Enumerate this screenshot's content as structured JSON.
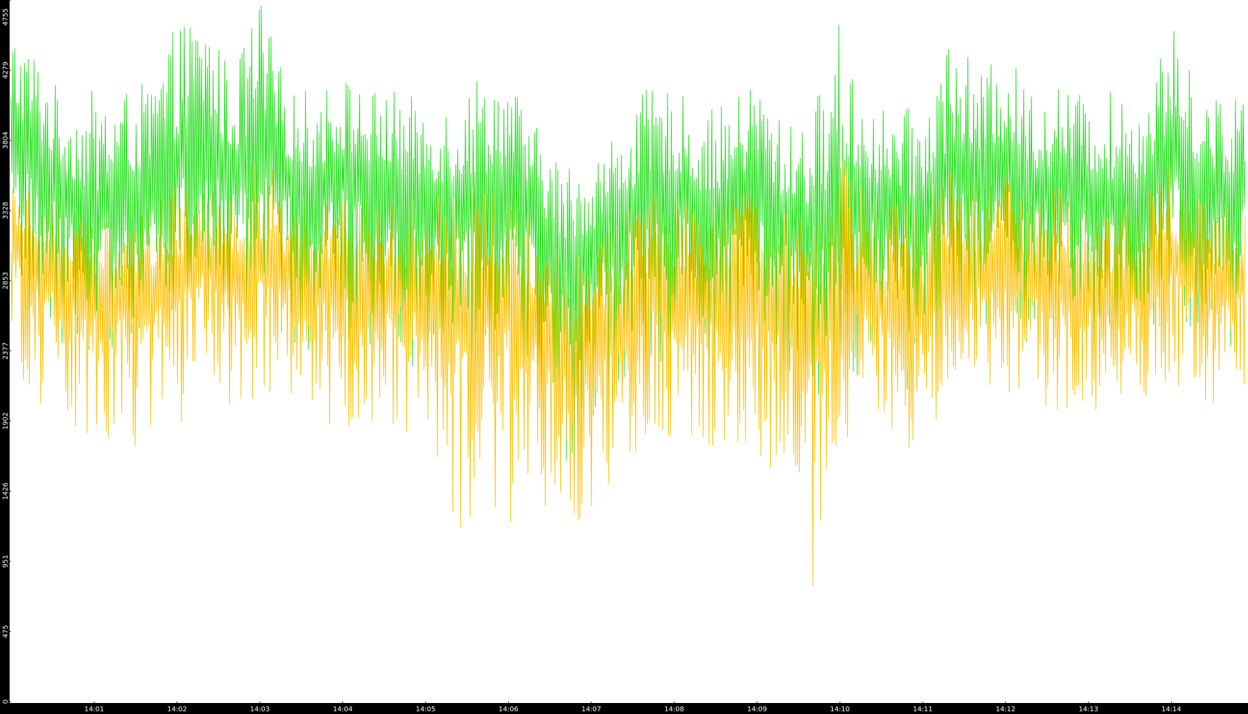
{
  "chart_data": {
    "type": "line",
    "title": "",
    "xlabel": "",
    "ylabel": "",
    "ylim": [
      0,
      4755
    ],
    "xlim_minutes": [
      14.0,
      15.0
    ],
    "x_ticks": [
      "14:01",
      "14:02",
      "14:03",
      "14:04",
      "14:05",
      "14:06",
      "14:07",
      "14:08",
      "14:09",
      "14:10",
      "14:11",
      "14:12",
      "14:13",
      "14:14"
    ],
    "y_ticks": [
      "0",
      "475",
      "951",
      "1426",
      "1902",
      "2377",
      "2853",
      "3328",
      "3804",
      "4279",
      "4755"
    ],
    "grid": false,
    "legend": "none",
    "series": [
      {
        "color": "#22e01a",
        "x": [
          "14:00:00",
          "14:00:20",
          "14:00:40",
          "14:01:00",
          "14:01:20",
          "14:01:40",
          "14:02:00",
          "14:02:20",
          "14:02:40",
          "14:03:00",
          "14:03:20",
          "14:03:40",
          "14:04:00",
          "14:04:20",
          "14:04:40",
          "14:05:00",
          "14:05:20",
          "14:05:40",
          "14:06:00",
          "14:06:20",
          "14:06:40",
          "14:07:00",
          "14:07:20",
          "14:07:40",
          "14:08:00",
          "14:08:20",
          "14:08:40",
          "14:09:00",
          "14:09:20",
          "14:09:40",
          "14:10:00",
          "14:10:20",
          "14:10:40",
          "14:11:00",
          "14:11:20",
          "14:11:40",
          "14:12:00",
          "14:12:20",
          "14:12:40",
          "14:13:00",
          "14:13:20",
          "14:13:40",
          "14:14:00",
          "14:14:20",
          "14:14:40",
          "14:15:00"
        ],
        "values": [
          3900,
          3700,
          3500,
          3300,
          3450,
          3500,
          3700,
          3850,
          3600,
          3750,
          3600,
          3500,
          3650,
          3550,
          3500,
          3450,
          3400,
          3450,
          3550,
          3300,
          3000,
          3100,
          3300,
          3450,
          3500,
          3350,
          3400,
          3550,
          3300,
          3250,
          3400,
          3450,
          3350,
          3300,
          3650,
          3600,
          3700,
          3500,
          3550,
          3500,
          3400,
          3450,
          3800,
          3550,
          3450,
          3600
        ],
        "min": [
          2700,
          2500,
          2400,
          2350,
          2400,
          2500,
          2600,
          2700,
          2450,
          2600,
          2450,
          2300,
          2400,
          2350,
          2300,
          2250,
          2200,
          2300,
          2350,
          2050,
          1500,
          1700,
          2050,
          2250,
          2350,
          2200,
          2250,
          2350,
          2100,
          1950,
          2100,
          2250,
          2150,
          2000,
          2600,
          2500,
          2350,
          2400,
          2300,
          2400,
          2250,
          2350,
          2550,
          2350,
          2300,
          2400
        ],
        "max": [
          4600,
          4400,
          4050,
          4150,
          4150,
          4200,
          4600,
          4700,
          4250,
          4800,
          4150,
          4150,
          4250,
          4150,
          4150,
          4050,
          4100,
          4300,
          4250,
          3900,
          3650,
          3700,
          3900,
          4150,
          4150,
          4000,
          4050,
          4250,
          3900,
          4000,
          4650,
          4050,
          4000,
          4050,
          4600,
          4250,
          4400,
          4150,
          4200,
          4100,
          4150,
          4150,
          4600,
          4150,
          4100,
          4300
        ]
      },
      {
        "color": "#ffc000",
        "x": [
          "14:00:00",
          "14:00:20",
          "14:00:40",
          "14:01:00",
          "14:01:20",
          "14:01:40",
          "14:02:00",
          "14:02:20",
          "14:02:40",
          "14:03:00",
          "14:03:20",
          "14:03:40",
          "14:04:00",
          "14:04:20",
          "14:04:40",
          "14:05:00",
          "14:05:20",
          "14:05:40",
          "14:06:00",
          "14:06:20",
          "14:06:40",
          "14:07:00",
          "14:07:20",
          "14:07:40",
          "14:08:00",
          "14:08:20",
          "14:08:40",
          "14:09:00",
          "14:09:20",
          "14:09:40",
          "14:10:00",
          "14:10:20",
          "14:10:40",
          "14:11:00",
          "14:11:20",
          "14:11:40",
          "14:12:00",
          "14:12:20",
          "14:12:40",
          "14:13:00",
          "14:13:20",
          "14:13:40",
          "14:14:00",
          "14:14:20",
          "14:14:40",
          "14:15:00"
        ],
        "values": [
          3150,
          3050,
          2850,
          2750,
          2800,
          2850,
          2900,
          3050,
          2900,
          3000,
          2950,
          2850,
          2950,
          2900,
          2850,
          2850,
          2750,
          2800,
          2800,
          2650,
          2450,
          2500,
          2650,
          2800,
          2850,
          2750,
          2800,
          2850,
          2700,
          2600,
          2750,
          2800,
          2700,
          2700,
          3000,
          2950,
          3000,
          2850,
          2900,
          2850,
          2800,
          2850,
          3050,
          2900,
          2850,
          2950
        ],
        "min": [
          2300,
          2000,
          1850,
          1800,
          1700,
          1750,
          1750,
          2050,
          1900,
          2000,
          1950,
          1850,
          1850,
          1900,
          1800,
          1750,
          1150,
          1100,
          1000,
          1350,
          1200,
          1250,
          1600,
          1750,
          1800,
          1700,
          1700,
          1650,
          1500,
          750,
          1700,
          1850,
          1800,
          1500,
          2200,
          2150,
          2100,
          2000,
          1950,
          1950,
          2000,
          2050,
          2150,
          2000,
          1950,
          1850
        ],
        "max": [
          3600,
          3500,
          3400,
          3300,
          3300,
          3350,
          3550,
          3700,
          3400,
          3750,
          3450,
          3450,
          3550,
          3450,
          3450,
          3400,
          3450,
          3500,
          3500,
          3300,
          3150,
          3200,
          3350,
          3500,
          3450,
          3350,
          3450,
          3550,
          3350,
          3350,
          3700,
          3450,
          3400,
          3450,
          3700,
          3550,
          3650,
          3450,
          3500,
          3400,
          3450,
          3450,
          3700,
          3450,
          3450,
          3600
        ]
      }
    ]
  }
}
